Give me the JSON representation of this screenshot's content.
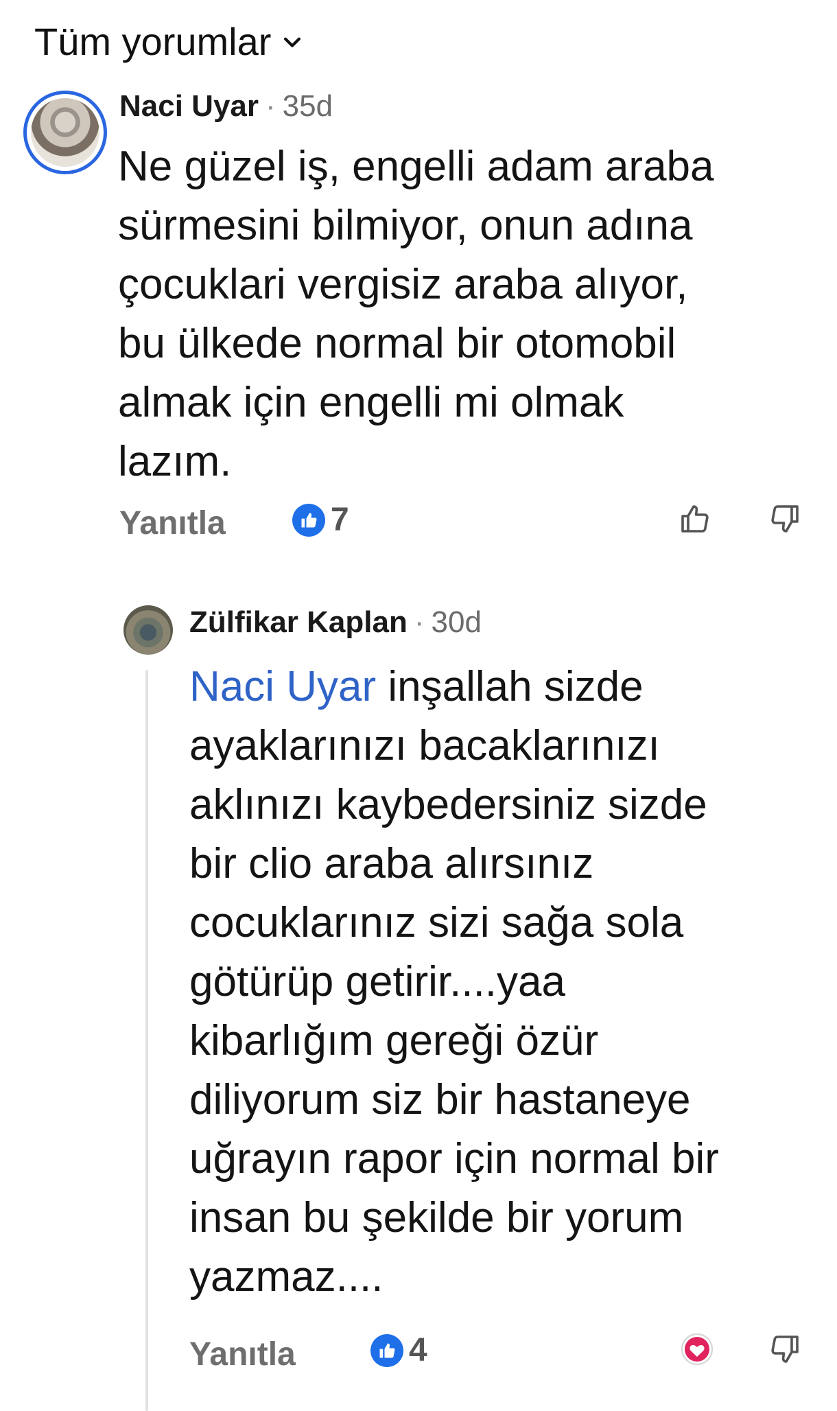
{
  "header": {
    "filter_label": "Tüm yorumlar"
  },
  "comments": [
    {
      "author": "Naci Uyar",
      "separator": "·",
      "time": "35d",
      "text": "Ne güzel iş, engelli adam araba\nsürmesini bilmiyor, onun adına\nçocuklari vergisiz araba alıyor,\nbu ülkede normal bir otomobil\nalmak için engelli mi olmak\nlazım.",
      "reply_label": "Yanıtla",
      "reaction_count": "7"
    }
  ],
  "replies": [
    {
      "author": "Zülfikar Kaplan",
      "separator": "·",
      "time": "30d",
      "mention": "Naci Uyar",
      "text": " inşallah sizde\nayaklarınızı bacaklarınızı\naklınızı kaybedersiniz sizde\nbir clio araba alırsınız\ncocuklarınız sizi sağa sola\ngötürüp getirir....yaa\nkibarlığım gereği özür\ndiliyorum siz bir hastaneye\nuğrayın rapor için normal bir\ninsan bu şekilde bir yorum\nyazmaz....",
      "reply_label": "Yanıtla",
      "reaction_count": "4"
    }
  ],
  "colors": {
    "accent": "#1e6fe8",
    "mention": "#2f63c7",
    "heart": "#e0245e"
  }
}
